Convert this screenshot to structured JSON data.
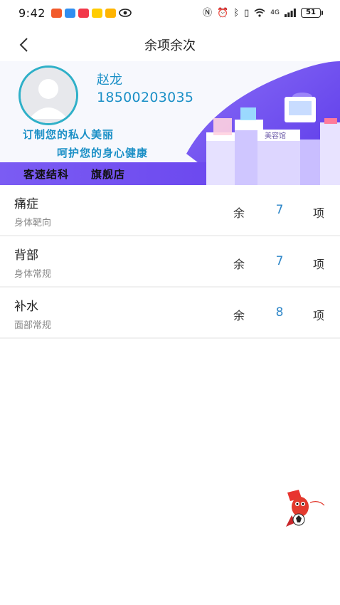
{
  "status_bar": {
    "time": "9:42",
    "network": "4G",
    "battery": "51"
  },
  "header": {
    "title": "余项余次"
  },
  "profile": {
    "name": "赵龙",
    "phone": "18500203035"
  },
  "banner": {
    "slogan_line1": "订制您的私人美丽",
    "slogan_line2": "呵护您的身心健康",
    "store_name": "客速结科",
    "store_suffix": "旗舰店",
    "sign_text": "美容馆"
  },
  "items": [
    {
      "name": "痛症",
      "category": "身体靶向",
      "remain_label": "余",
      "count": "7",
      "unit": "项"
    },
    {
      "name": "背部",
      "category": "身体常规",
      "remain_label": "余",
      "count": "7",
      "unit": "项"
    },
    {
      "name": "补水",
      "category": "面部常规",
      "remain_label": "余",
      "count": "8",
      "unit": "项"
    }
  ],
  "colors": {
    "accent_blue": "#1a8fc6",
    "count_blue": "#2d86c8",
    "banner_purple": "#6f4ef2"
  },
  "icons": {
    "back": "chevron-left-icon",
    "avatar": "default-user-icon"
  }
}
